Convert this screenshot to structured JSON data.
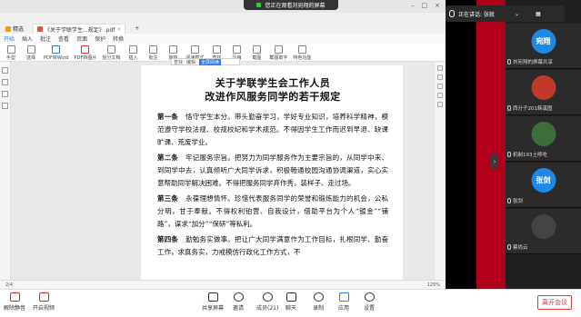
{
  "banner": {
    "text": "您正在观看刘宛翔的屏幕"
  },
  "browser": {
    "tabs": [
      {
        "label": "精选",
        "active": false
      },
      {
        "label": "《关于学联学生...规定》.pdf",
        "active": true
      },
      {
        "label": "+",
        "active": false
      }
    ],
    "menu": [
      "开始",
      "插入",
      "批注",
      "查看",
      "页面",
      "保护",
      "转换"
    ],
    "menu_active": "开始",
    "tools": [
      "手型",
      "选择",
      "PDF转Word",
      "PDF转图片",
      "划分文档",
      "插入",
      "批注",
      "旋转",
      "阅读模式",
      "查找",
      "压缩",
      "截图",
      "截图取字",
      "特色功能"
    ],
    "subbar": [
      "查找",
      "编辑",
      "全屏阅读"
    ],
    "status": {
      "page": "2/4",
      "zoom": "125%"
    }
  },
  "document": {
    "title_line1": "关于学联学生会工作人员",
    "title_line2": "改进作风服务同学的若干规定",
    "articles": [
      {
        "head": "第一条",
        "text": "恪守学生本分。带头勤奋学习，学好专业知识，培养科学精神，模范遵守学校法规、校规校纪和学术规范。不得因学生工作而迟到早退、缺课旷课、荒废学业。"
      },
      {
        "head": "第二条",
        "text": "牢记服务宗旨。把努力为同学服务作为主要宗旨的，从同学中来、到同学中去，认真倾听广大同学诉求，积极畅通校园沟通协调渠道，实心实意帮助同学解决困难。不得把服务同学弃作秀，装样子、走过场。"
      },
      {
        "head": "第三条",
        "text": "永葆理想情怀。珍惜代表服务同学的荣誉和锻炼能力的机会，公私分明，甘于奉献。不得权利铂营、自我设计，借助平台为个人“镀金”“铺路”，谋求“加分”“保研”等私利。"
      },
      {
        "head": "第四条",
        "text": "勤勉务实做事。把让广大同学满意作为工作目标，扎根同学、勤奋工作，求真务实，力戒模仿行政化工作方式，不"
      }
    ]
  },
  "speaking": {
    "label": "正在讲话: 张就"
  },
  "participants": [
    {
      "avatar_text": "宛翔",
      "name": "刘宛翔的屏幕共享",
      "color": "#1e88e5"
    },
    {
      "avatar_text": "",
      "name": "西分子201韩溪图",
      "color": "#c0392b"
    },
    {
      "avatar_text": "",
      "name": "机制193土哆吃",
      "color": "#3c6e3c"
    },
    {
      "avatar_text": "张剑",
      "name": "张剑",
      "color": "#1e88e5"
    },
    {
      "avatar_text": "",
      "name": "蔡尚云",
      "color": "#444444"
    }
  ],
  "toolbar": {
    "mute": "解除静音",
    "video": "开启视频",
    "share": "共享屏幕",
    "invite": "邀请",
    "members": "成员(21)",
    "chat": "聊天",
    "record": "录制",
    "apps": "应用",
    "settings": "设置",
    "leave": "离开会议"
  }
}
